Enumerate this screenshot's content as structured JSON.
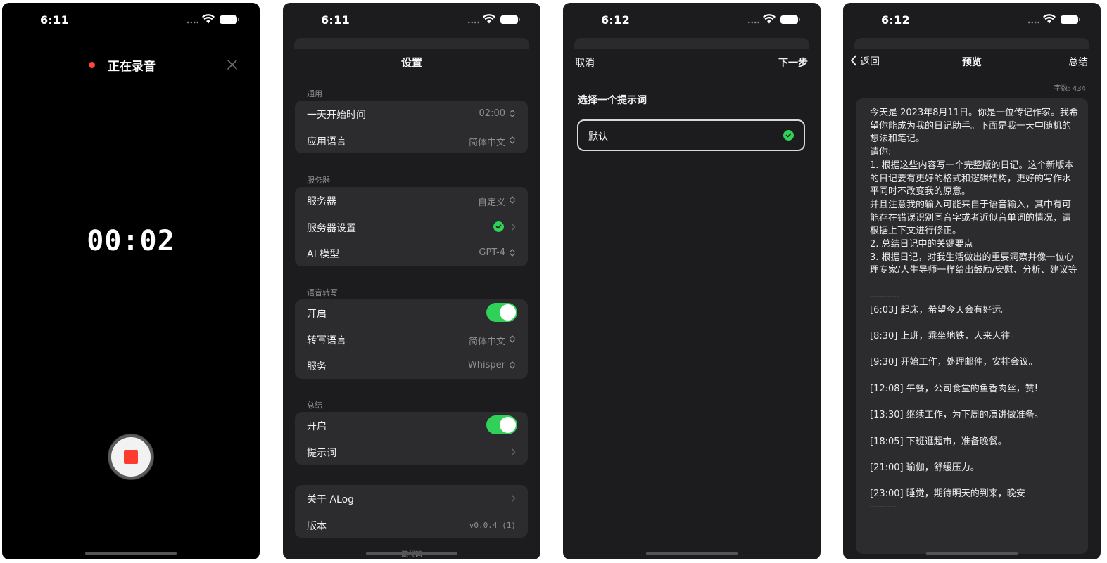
{
  "colors": {
    "accent_green": "#30d158",
    "record_red": "#ff3b30",
    "dark_bg": "#1c1c1e",
    "card_bg": "#2c2c2e"
  },
  "panel1": {
    "status_time": "6:11",
    "title": "正在录音",
    "timer": "00:02",
    "icons": {
      "close": "close-icon",
      "stop": "stop-icon"
    }
  },
  "panel2": {
    "status_time": "6:11",
    "title": "设置",
    "general": {
      "header": "通用",
      "day_start": {
        "label": "一天开始时间",
        "value": "02:00"
      },
      "app_language": {
        "label": "应用语言",
        "value": "简体中文"
      }
    },
    "server": {
      "header": "服务器",
      "server": {
        "label": "服务器",
        "value": "自定义"
      },
      "server_settings": {
        "label": "服务器设置"
      },
      "ai_model": {
        "label": "AI 模型",
        "value": "GPT-4"
      }
    },
    "transcription": {
      "header": "语音转写",
      "enable": {
        "label": "开启",
        "on": true
      },
      "language": {
        "label": "转写语言",
        "value": "简体中文"
      },
      "service": {
        "label": "服务",
        "value": "Whisper"
      }
    },
    "summary": {
      "header": "总结",
      "enable": {
        "label": "开启",
        "on": true
      },
      "prompt": {
        "label": "提示词"
      }
    },
    "about": {
      "about_app": {
        "label": "关于 ALog"
      },
      "version": {
        "label": "版本",
        "value": "v0.0.4 (1)"
      }
    },
    "source_code": "源代码"
  },
  "panel3": {
    "status_time": "6:12",
    "cancel": "取消",
    "next": "下一步",
    "heading": "选择一个提示词",
    "options": [
      {
        "label": "默认",
        "selected": true
      }
    ]
  },
  "panel4": {
    "status_time": "6:12",
    "back": "返回",
    "title": "预览",
    "summary": "总结",
    "word_count": "字数: 434",
    "content": "今天是 2023年8月11日。你是一位传记作家。我希望你能成为我的日记助手。下面是我一天中随机的想法和笔记。\n请你:\n1. 根据这些内容写一个完整版的日记。这个新版本的日记要有更好的格式和逻辑结构，更好的写作水平同时不改变我的原意。\n并且注意我的输入可能来自于语音输入，其中有可能存在错误识别同音字或者近似音单词的情况，请根据上下文进行修正。\n2. 总结日记中的关键要点\n3. 根据日记，对我生活做出的重要洞察并像一位心理专家/人生导师一样给出鼓励/安慰、分析、建议等\n\n---------\n[6:03] 起床，希望今天会有好运。\n\n[8:30] 上班，乘坐地铁，人来人往。\n\n[9:30] 开始工作，处理邮件，安排会议。\n\n[12:08] 午餐，公司食堂的鱼香肉丝，赞!\n\n[13:30] 继续工作，为下周的演讲做准备。\n\n[18:05] 下班逛超市，准备晚餐。\n\n[21:00] 瑜伽，舒缓压力。\n\n[23:00] 睡觉，期待明天的到来，晚安\n--------"
  }
}
